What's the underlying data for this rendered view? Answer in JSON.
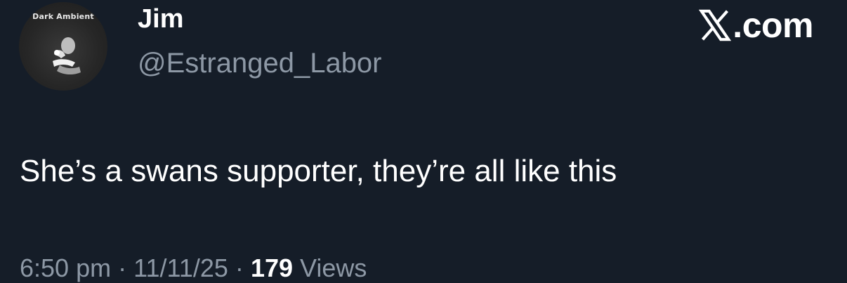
{
  "author": {
    "display_name": "Jim",
    "handle": "@Estranged_Labor",
    "avatar_logo_text": "Dark Ambient"
  },
  "brand": {
    "icon": "x-logo-icon",
    "label": ".com"
  },
  "tweet": {
    "text": "She’s a swans supporter, they’re all like this"
  },
  "meta": {
    "time": "6:50 pm",
    "separator": "·",
    "date": "11/11/25",
    "views_count": "179",
    "views_label": "Views"
  },
  "colors": {
    "background": "#151d28",
    "primary_text": "#ffffff",
    "secondary_text": "#8d98a5"
  }
}
